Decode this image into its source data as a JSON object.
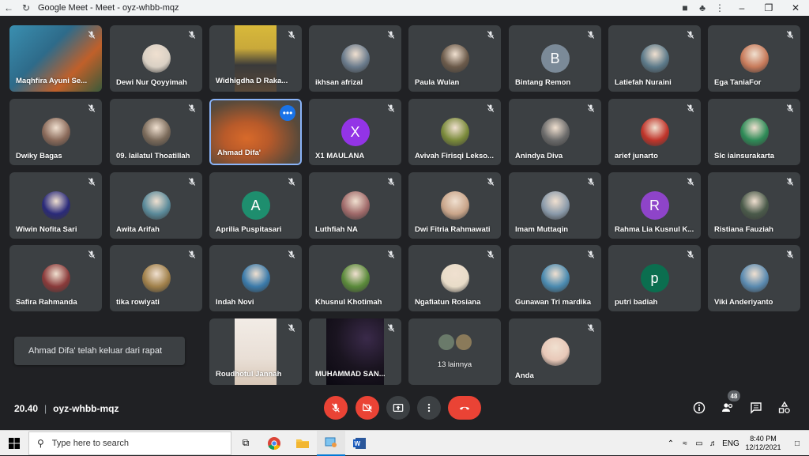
{
  "window": {
    "title": "Google Meet - Meet - oyz-whbb-mqz"
  },
  "participants": [
    {
      "name": "Maqhfira Ayuni Se...",
      "type": "video",
      "color": "#2e6b8a"
    },
    {
      "name": "Dewi Nur Qoyyimah",
      "type": "photo",
      "color": "#d9d0c4"
    },
    {
      "name": "Widhigdha D Raka...",
      "type": "video",
      "color": "#c9a93a"
    },
    {
      "name": "ikhsan afrizal",
      "type": "photo",
      "color": "#6a7b8c"
    },
    {
      "name": "Paula Wulan",
      "type": "photo",
      "color": "#6b5a4a"
    },
    {
      "name": "Bintang Remon",
      "type": "letter",
      "letter": "B",
      "color": "#7b8a98"
    },
    {
      "name": "Latiefah Nuraini",
      "type": "photo",
      "color": "#5c7a8a"
    },
    {
      "name": "Ega TaniaFor",
      "type": "photo",
      "color": "#c77a5a"
    },
    {
      "name": "Dwiky Bagas",
      "type": "photo",
      "color": "#8a6a5a"
    },
    {
      "name": "09. lailatul Thoatillah",
      "type": "photo",
      "color": "#7a6a5a"
    },
    {
      "name": "Ahmad Difa'",
      "type": "video",
      "color": "#b85a2a"
    },
    {
      "name": "X1 MAULANA",
      "type": "letter",
      "letter": "X",
      "color": "#9334e6"
    },
    {
      "name": "Avivah Firisqi Lekso...",
      "type": "photo",
      "color": "#7a8a3a"
    },
    {
      "name": "Anindya Diva",
      "type": "photo",
      "color": "#6a6a6a"
    },
    {
      "name": "arief junarto",
      "type": "photo",
      "color": "#c0342a"
    },
    {
      "name": "Slc iainsurakarta",
      "type": "photo",
      "color": "#2e8b57"
    },
    {
      "name": "Wiwin Nofita Sari",
      "type": "photo",
      "color": "#2a2a7a"
    },
    {
      "name": "Awita Arifah",
      "type": "photo",
      "color": "#5a8a9a"
    },
    {
      "name": "Aprilia Puspitasari",
      "type": "letter",
      "letter": "A",
      "color": "#1e8e6e"
    },
    {
      "name": "Luthfiah NA",
      "type": "photo",
      "color": "#a06a6a"
    },
    {
      "name": "Dwi Fitria Rahmawati",
      "type": "photo",
      "color": "#c9a58a"
    },
    {
      "name": "Imam Muttaqin",
      "type": "photo",
      "color": "#8a9aaa"
    },
    {
      "name": "Rahma Lia Kusnul K...",
      "type": "letter",
      "letter": "R",
      "color": "#8e44c9"
    },
    {
      "name": "Ristiana Fauziah",
      "type": "photo",
      "color": "#4a5a4a"
    },
    {
      "name": "Safira Rahmanda",
      "type": "photo",
      "color": "#8a3a3a"
    },
    {
      "name": "tika rowiyati",
      "type": "photo",
      "color": "#a0804a"
    },
    {
      "name": "Indah Novi",
      "type": "photo",
      "color": "#3a7aaa"
    },
    {
      "name": "Khusnul Khotimah",
      "type": "photo",
      "color": "#5a8a3a"
    },
    {
      "name": "Ngafiatun Rosiana",
      "type": "photo",
      "color": "#e8dcc8"
    },
    {
      "name": "Gunawan Tri mardika",
      "type": "photo",
      "color": "#4a8ab0"
    },
    {
      "name": "putri badiah",
      "type": "letter",
      "letter": "p",
      "color": "#0b6e4f"
    },
    {
      "name": "Viki Anderiyanto",
      "type": "photo",
      "color": "#5a8ab0"
    },
    {
      "name": "Roudhotul Jannah",
      "type": "video",
      "color": "#e9dfd6"
    },
    {
      "name": "MUHAMMAD SAN...",
      "type": "video",
      "color": "#1a1420"
    },
    {
      "name": "13 lainnya",
      "type": "others",
      "color": "#6a7a6a"
    },
    {
      "name": "Anda",
      "type": "photo",
      "color": "#e8c8b8"
    }
  ],
  "toast": "Ahmad Difa' telah keluar dari rapat",
  "meeting": {
    "time": "20.40",
    "separator": "|",
    "code": "oyz-whbb-mqz"
  },
  "people_count": "48",
  "taskbar": {
    "search_placeholder": "Type here to search",
    "lang": "ENG",
    "time": "8:40 PM",
    "date": "12/12/2021"
  },
  "colors": {
    "background": "#202124",
    "tile": "#3c4043",
    "end_call": "#ea4335",
    "active_border": "#8ab4f8"
  }
}
